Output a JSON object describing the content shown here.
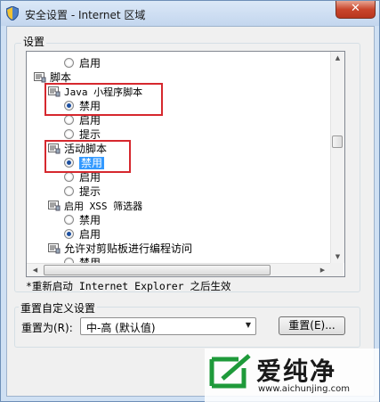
{
  "window": {
    "title": "安全设置 - Internet 区域",
    "close_glyph": "✕"
  },
  "settings_group": {
    "label": "设置"
  },
  "tree": [
    {
      "type": "radio",
      "label": "启用",
      "checked": false
    },
    {
      "type": "category",
      "label": "脚本"
    },
    {
      "type": "category",
      "label": "Java 小程序脚本"
    },
    {
      "type": "radio",
      "label": "禁用",
      "checked": true
    },
    {
      "type": "radio",
      "label": "启用",
      "checked": false
    },
    {
      "type": "radio",
      "label": "提示",
      "checked": false
    },
    {
      "type": "category",
      "label": "活动脚本"
    },
    {
      "type": "radio",
      "label": "禁用",
      "checked": true,
      "selected": true
    },
    {
      "type": "radio",
      "label": "启用",
      "checked": false
    },
    {
      "type": "radio",
      "label": "提示",
      "checked": false
    },
    {
      "type": "category",
      "label": "启用 XSS 筛选器"
    },
    {
      "type": "radio",
      "label": "禁用",
      "checked": false
    },
    {
      "type": "radio",
      "label": "启用",
      "checked": true
    },
    {
      "type": "category",
      "label": "允许对剪贴板进行编程访问"
    },
    {
      "type": "radio",
      "label": "禁用",
      "checked": false
    }
  ],
  "restart_note": "*重新启动 Internet Explorer 之后生效",
  "reset_group": {
    "label": "重置自定义设置",
    "reset_to_label": "重置为(R):",
    "level_value": "中-高 (默认值)",
    "reset_button": "重置(E)..."
  },
  "watermark": {
    "brand": "爱纯净",
    "url": "www.aichunjing.com"
  },
  "colors": {
    "selection": "#3399ff",
    "annotation_box": "#d6282e",
    "logo_green": "#1e9a3a"
  }
}
